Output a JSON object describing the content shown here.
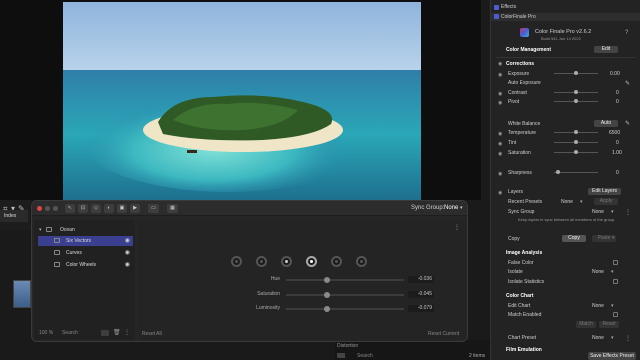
{
  "plugin": {
    "toolbar_icons": [
      "cursor-icon",
      "crop-icon",
      "transform-icon",
      "color-icon",
      "mask-icon",
      "play-icon",
      "split-view-icon",
      "grid-icon"
    ],
    "sync_label": "Sync Group:",
    "sync_value": "None",
    "layers": [
      {
        "name": "Ocean",
        "type": "folder"
      },
      {
        "name": "Six Vectors",
        "type": "item",
        "selected": true
      },
      {
        "name": "Curves",
        "type": "item"
      },
      {
        "name": "Color Wheels",
        "type": "item"
      }
    ],
    "layer_footer": {
      "zoom": "100 %",
      "search_placeholder": "Search"
    },
    "sliders": [
      {
        "label": "Hue",
        "value": "-0.036",
        "position": 0.5
      },
      {
        "label": "Saturation",
        "value": "-0.045",
        "position": 0.5
      },
      {
        "label": "Luminosity",
        "value": "-0.079",
        "position": 0.5
      }
    ],
    "reset_all": "Reset All",
    "reset_current": "Reset Current"
  },
  "left": {
    "index_tab": "Index"
  },
  "inspector": {
    "effects_label": "Effects",
    "plugin_row": "ColorFinale Pro",
    "app_title": "Color Finale Pro v2.6.2",
    "build": "Build 541 Jun 14 2022",
    "color_management": "Color Management",
    "edit_btn": "Edit",
    "corrections": "Corrections",
    "rows": {
      "exposure": {
        "label": "Exposure",
        "value": "0.00"
      },
      "auto_exposure": "Auto Exposure",
      "contrast": {
        "label": "Contrast",
        "value": "0"
      },
      "pivot": {
        "label": "Pivot",
        "value": "0"
      },
      "white_balance": {
        "label": "White Balance",
        "button": "Auto"
      },
      "temperature": {
        "label": "Temperature",
        "value": "6500"
      },
      "tint": {
        "label": "Tint",
        "value": "0"
      },
      "saturation": {
        "label": "Saturation",
        "value": "1.00"
      },
      "sharpness": {
        "label": "Sharpness",
        "value": "0"
      }
    },
    "layers": "Layers",
    "edit_layers": "Edit Layers",
    "recent_presets": "Recent Presets",
    "recent_value": "None",
    "apply": "Apply",
    "sync_group": "Sync Group",
    "sync_value": "None",
    "sync_hint": "Keep layers in sync between all members of the group.",
    "copy_label": "Copy",
    "copy_btn": "Copy",
    "paste_btn": "Paste",
    "image_analysis": "Image Analysis",
    "false_color": "False Color",
    "isolate": "Isolate",
    "isolate_value": "None",
    "isolate_statistics": "Isolate Statistics",
    "color_chart": "Color Chart",
    "edit_chart": "Edit Chart",
    "edit_chart_value": "None",
    "match_enabled": "Match Enabled",
    "match_btn": "Match",
    "reset_btn": "Reset",
    "chart_preset": "Chart Preset",
    "chart_preset_value": "None",
    "film_emulation": "Film Emulation",
    "save_preset": "Save Effects Preset"
  },
  "bottom": {
    "distortion": "Distortion",
    "search_placeholder": "Search",
    "items_count": "2 items"
  },
  "colors": {
    "accent": "#4f5bd5",
    "selection": "#3a3f8f"
  }
}
